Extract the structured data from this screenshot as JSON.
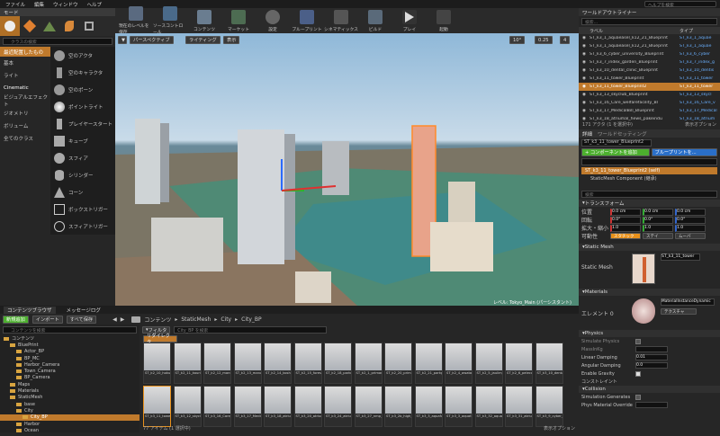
{
  "menu": [
    "ファイル",
    "編集",
    "ウィンドウ",
    "ヘルプ"
  ],
  "search_help": {
    "placeholder": "ヘルプを検索"
  },
  "modes": {
    "tab": "モード",
    "search_placeholder": "クラスの検索"
  },
  "categories": [
    "最近配置したもの",
    "基本",
    "ライト",
    "Cinematic",
    "ビジュアルエフェクト",
    "ジオメトリ",
    "ボリューム",
    "全てのクラス"
  ],
  "placeables": [
    "空のアクタ",
    "空のキャラクタ",
    "空のポーン",
    "ポイントライト",
    "プレイヤースタート",
    "キューブ",
    "スフィア",
    "シリンダー",
    "コーン",
    "ボックストリガー",
    "スフィアトリガー"
  ],
  "toolbar": [
    "現在のレベルを保存",
    "ソースコントロール",
    "コンテンツ",
    "マーケット",
    "設定",
    "ブループリント",
    "シネマティックス",
    "ビルド",
    "プレイ",
    "起動"
  ],
  "viewport": {
    "perspective": "パースペクティブ",
    "lighting": "ライティング",
    "show": "表示",
    "angle": "10°",
    "scale": "0.25",
    "cam": "4",
    "level_label": "レベル:",
    "level_value": "Tokyo_Main (パーシスタント)"
  },
  "outliner": {
    "tab": "ワールドアウトライナー",
    "search_placeholder": "検索...",
    "col_label": "ラベル",
    "col_type": "タイプ",
    "rows": [
      {
        "name": "ST_k3_1_aquaeasel_k12_21_Blueprint",
        "type": "ST_k3_1_aquae"
      },
      {
        "name": "ST_k3_1_aquaeasel_k12_21_Blueprint",
        "type": "ST_k3_1_aquae"
      },
      {
        "name": "ST_k3_6_cyber_university_Blueprint",
        "type": "ST_k3_6_cyber"
      },
      {
        "name": "ST_k3_7_index_garden_Blueprint",
        "type": "ST_k3_7_index_g"
      },
      {
        "name": "ST_k3_10_dental_clinic_Blueprint",
        "type": "ST_k3_10_dentis"
      },
      {
        "name": "ST_k3_11_tower_Blueprint",
        "type": "ST_k3_11_tower"
      },
      {
        "name": "ST_k3_11_tower_Blueprint2",
        "type": "ST_k3_11_tower"
      },
      {
        "name": "ST_k3_13_skyclub_Blueprint",
        "type": "ST_k3_13_skycl"
      },
      {
        "name": "ST_k3_16_Care_welfarefacility_Bl",
        "type": "ST_k3_16_Care_v"
      },
      {
        "name": "ST_k3_17_MedicalBill_Blueprint",
        "type": "ST_k3_17_Medical"
      },
      {
        "name": "ST_k3_18_atriumal_hews_pakeindu",
        "type": "ST_k3_18_atrium"
      }
    ],
    "selected_index": 6,
    "count": "171 アクタ (1 を選択中)",
    "view_options": "表示オプション"
  },
  "details": {
    "tab": "詳細",
    "tab2": "ワールドセッティング",
    "name": "ST_k3_11_tower_Blueprint2",
    "add_component": "+ コンポーネントを追加",
    "blueprint": "ブループリントを...",
    "self": "ST_k3_11_tower_Blueprint2 (self)",
    "component": "StaticMesh Component (継承)",
    "search_placeholder": "検索",
    "transform": "トランスフォーム",
    "pos_label": "位置",
    "rot_label": "回転",
    "scale_label": "拡大・縮小",
    "mobility_label": "可動性",
    "location": [
      "0.0 cm",
      "0.0 cm",
      "0.0 cm"
    ],
    "rotation": [
      "0.0°",
      "0.0°",
      "0.0°"
    ],
    "scale": [
      "1.0",
      "1.0",
      "1.0"
    ],
    "mobility": [
      "スタチック",
      "ステイ",
      "ムーバ"
    ],
    "static_mesh_section": "Static Mesh",
    "static_mesh_label": "Static Mesh",
    "static_mesh_value": "ST_k3_11_tower",
    "materials_section": "Materials",
    "element_label": "エレメント 0",
    "material_value": "MaterialInstanceDynamic",
    "texture": "テクスチャ",
    "physics_section": "Physics",
    "simulate": "Simulate Physics",
    "mass": "MassInKg",
    "linear": "Linear Damping",
    "linear_val": "0.01",
    "angular": "Angular Damping",
    "angular_val": "0.0",
    "gravity": "Enable Gravity",
    "constraints": "コンストレイント",
    "collision_section": "Collision",
    "sim_gen": "Simulation Generates",
    "phys_mat": "Phys Material Override"
  },
  "content": {
    "tab1": "コンテンツブラウザ",
    "tab2": "メッセージログ",
    "add_new": "新規追加",
    "import": "インポート",
    "save_all": "すべて保存",
    "path": [
      "コンテンツ",
      "StaticMesh",
      "City",
      "City_BP"
    ],
    "search_placeholder": "コンテンツを検索",
    "filter": "フィルタ",
    "search_path": "City_BP を検索",
    "dir_tag": "リダイレクタ",
    "item_count": "77 アイテム (1 選択中)",
    "view_options": "表示オプション",
    "tree": [
      "コンテンツ",
      "BluePrint",
      "Actor_BP",
      "BP_MC",
      "Harbor_Camera",
      "Town_Camera",
      "BP_Camera",
      "Maps",
      "Materials",
      "StaticMesh",
      "base",
      "City",
      "City_BP",
      "Harbor",
      "Ocean"
    ],
    "assets_row1": [
      "ST_k2_10_hokumi_Blueprint",
      "ST_k2_11_kourinsinkan_Blueprint",
      "ST_k2_12_mansiosouth_Blueprint",
      "ST_k2_13_manasouth_Blueprint",
      "ST_k2_14_koshiyama_Blueprint",
      "ST_k2_15_forestoasis_Blueprint",
      "ST_k2_18_parkoasis_Blueprint",
      "ST_k2_1_primary_school_Blueprint",
      "ST_k2_20_primary_school_Blueprint",
      "ST_k2_21_parkplaza_Blueprint",
      "ST_k2_4_awatahaya_Blueprint",
      "ST_k2_5_jaulim_Blueprint",
      "ST_k2_6_pelecare_Blueprint",
      "ST_k3_10_dental_clinic_Blueprint"
    ],
    "assets_row2": [
      "ST_k3_11_tower_Blueprint",
      "ST_k3_12_skyclub_Blueprint",
      "ST_k3_16_Care_welfarefa",
      "ST_k3_17_MedicalBill_Blueprint",
      "ST_k3_18_atrium_hall_Blueprint",
      "ST_k3_20_atrium_hall_Blueprint",
      "ST_k3_24_atrium_hall_Blueprint",
      "ST_k3_27_nmp_office_Blueprint",
      "ST_k3_2b_high_rehabilitation_Blueprint",
      "ST_k3_3_aquafantasy_Blueprint",
      "ST_k3_3_aquafantasy_32_01",
      "ST_k3_32_aquafantasy_32_02",
      "ST_k3_31_atrium_fukugun_Blueprint",
      "ST_k3_9_cyber_university_Blueprint"
    ]
  },
  "colors": {
    "accent": "#e8901a",
    "selection": "#c07a2c",
    "green_btn": "#4caf2e",
    "blue_btn": "#2a6fc9"
  }
}
